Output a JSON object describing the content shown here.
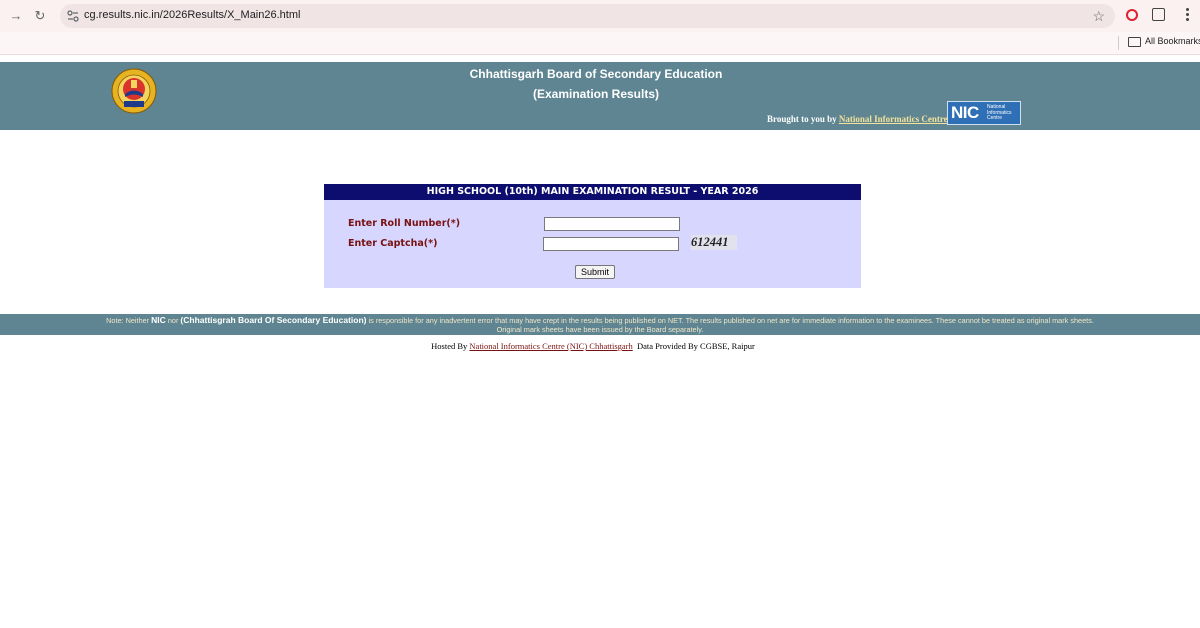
{
  "browser": {
    "url": "cg.results.nic.in/2026Results/X_Main26.html",
    "bookmarks_label": "All Bookmarks",
    "icons": [
      "back-arrow-icon",
      "reload-icon",
      "site-info-icon",
      "bookmark-star-icon",
      "opera-icon",
      "extensions-icon",
      "menu-dots-icon",
      "folder-icon"
    ]
  },
  "header": {
    "title": "Chhattisgarh Board of Secondary Education",
    "subtitle": "(Examination Results)",
    "brought_by_prefix": "Brought to you by",
    "brought_by_link": "National Informatics Centre",
    "nic_logo_text": "NIC",
    "nic_logo_small_text": "National Informatics Centre",
    "band_color": "#5e8591"
  },
  "form": {
    "heading": "HIGH SCHOOL (10th) MAIN  EXAMINATION RESULT - YEAR 2026",
    "roll_label": "Enter Roll Number(*)",
    "captcha_label": "Enter Captcha(*)",
    "roll_value": "",
    "captcha_input_value": "",
    "captcha_code": "612441",
    "submit_label": "Submit",
    "heading_color": "#0c0d6e",
    "box_color": "#d6d6ff"
  },
  "footer": {
    "note_prefix": "Note: Neither",
    "note_nic": "NIC",
    "note_nor": "nor",
    "note_board": "(Chhattisgrah Board Of Secondary Education)",
    "note_rest": "is responsible for any inadvertent error that may have crept in the results being published on NET. The results published on net are for immediate information to the examinees. These cannot be treated as original mark sheets.",
    "note_line2": "Original mark sheets have been issued by the Board separately.",
    "hosted_prefix": "Hosted By",
    "hosted_link": "National Informatics Centre (NIC) Chhattisgarh",
    "data_provided": "Data Provided By CGBSE, Raipur"
  }
}
